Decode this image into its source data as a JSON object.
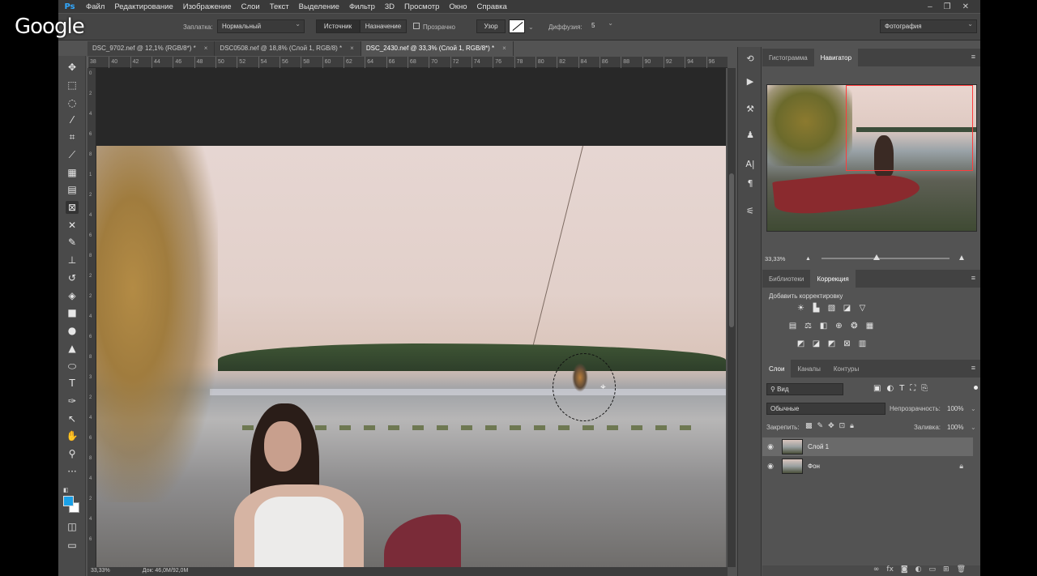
{
  "app": {
    "logo": "Ps"
  },
  "menu": [
    "Файл",
    "Редактирование",
    "Изображение",
    "Слои",
    "Текст",
    "Выделение",
    "Фильтр",
    "3D",
    "Просмотр",
    "Окно",
    "Справка"
  ],
  "window_controls": {
    "minimize": "–",
    "restore": "❐",
    "close": "✕"
  },
  "overlay_logo": "Google",
  "options_bar": {
    "patch_label": "Заплатка:",
    "patch_mode": "Нормальный",
    "source_button": "Источник",
    "destination_button": "Назначение",
    "transparent_label": "Прозрачно",
    "pattern_button": "Узор",
    "diffusion_label": "Диффузия:",
    "diffusion_value": "5",
    "workspace": "Фотография"
  },
  "tabs": [
    {
      "label": "DSC_9702.nef @ 12,1% (RGB/8*) *",
      "close": "×"
    },
    {
      "label": "DSC0508.nef @ 18,8% (Слой 1, RGB/8) *",
      "close": "×"
    },
    {
      "label": "DSC_2430.nef @ 33,3% (Слой 1, RGB/8*) *",
      "close": "×"
    }
  ],
  "ruler_h": [
    "38",
    "40",
    "42",
    "44",
    "46",
    "48",
    "50",
    "52",
    "54",
    "56",
    "58",
    "60",
    "62",
    "64",
    "66",
    "68",
    "70",
    "72",
    "74",
    "76",
    "78",
    "80",
    "82",
    "84",
    "86",
    "88",
    "90",
    "92",
    "94",
    "96"
  ],
  "ruler_v": [
    "0",
    "2",
    "4",
    "6",
    "8",
    "1",
    "2",
    "4",
    "6",
    "8",
    "2",
    "2",
    "4",
    "6",
    "8",
    "3",
    "2",
    "4",
    "6",
    "8",
    "4",
    "2",
    "4",
    "6"
  ],
  "status": {
    "zoom": "33,33%",
    "doc": "Док: 46,0M/92,0M"
  },
  "toolbar_icons": [
    "move-icon",
    "marquee-icon",
    "lasso-icon",
    "magic-wand-icon",
    "crop-icon",
    "eyedropper-icon",
    "spot-healing-icon",
    "patch-icon",
    "content-aware-move-icon",
    "red-eye-icon",
    "brush-icon",
    "clone-stamp-icon",
    "history-brush-icon",
    "eraser-icon",
    "gradient-icon",
    "blur-icon",
    "dodge-icon",
    "pen-icon",
    "type-icon",
    "path-select-icon",
    "hand-icon",
    "zoom-icon",
    "more-icon"
  ],
  "colors": {
    "foreground": "#1aa0e6",
    "background": "#ffffff",
    "nav_box": "#ff3b3b"
  },
  "panels": {
    "nav_tabs": {
      "histogram": "Гистограмма",
      "navigator": "Навигатор"
    },
    "zoom_value": "33,33%",
    "adj_tabs": {
      "libraries": "Библиотеки",
      "corrections": "Коррекция"
    },
    "adjustments_title": "Добавить корректировку",
    "layer_tabs": {
      "layers": "Слои",
      "channels": "Каналы",
      "paths": "Контуры"
    },
    "kind_filter": "Вид",
    "blend_mode": "Обычные",
    "opacity_label": "Непрозрачность:",
    "opacity_value": "100%",
    "lock_label": "Закрепить:",
    "fill_label": "Заливка:",
    "fill_value": "100%",
    "layers": [
      {
        "name": "Слой 1",
        "selected": true,
        "locked": false
      },
      {
        "name": "Фон",
        "selected": false,
        "locked": true
      }
    ]
  }
}
